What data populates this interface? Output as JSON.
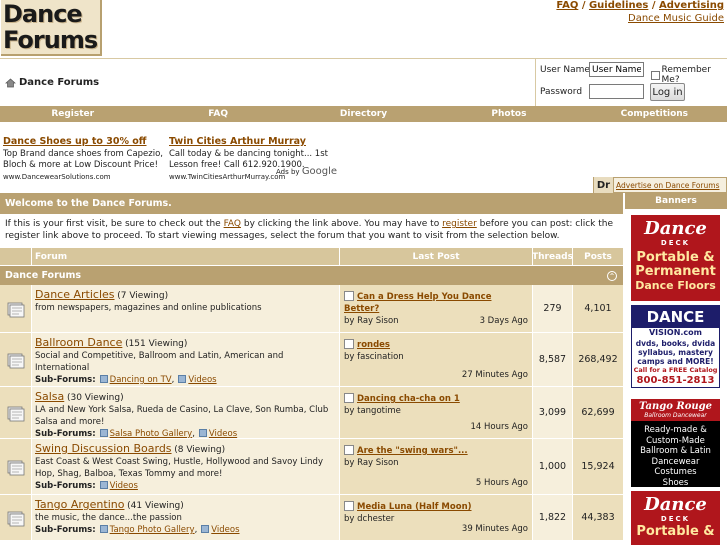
{
  "header": {
    "logo_line1": "Dance",
    "logo_line2": "Forums",
    "links": [
      "FAQ",
      "Guidelines",
      "Advertising"
    ],
    "separator": " / ",
    "sub_link": "Dance Music Guide"
  },
  "breadcrumb": {
    "label": "Dance Forums"
  },
  "login": {
    "user_label": "User Name",
    "user_value": "User Name",
    "pass_label": "Password",
    "remember_label": "Remember Me?",
    "button": "Log in"
  },
  "menu": [
    "Register",
    "FAQ",
    "Directory",
    "Photos",
    "Competitions"
  ],
  "ads": [
    {
      "title": "Dance Shoes up to 30% off",
      "lines": [
        "Top Brand dance shoes from Capezio,",
        "Bloch & more at Low Discount Price!"
      ],
      "url": "www.DancewearSolutions.com"
    },
    {
      "title": "Twin Cities Arthur Murray",
      "lines": [
        "Call today & be dancing tonight... 1st",
        "Lesson free! Call 612.920.1900."
      ],
      "url": "www.TwinCitiesArthurMurray.com"
    }
  ],
  "ads_by": "Ads by",
  "ads_by_brand": "Google",
  "advertise": {
    "badge": "Dr",
    "label": "Advertise on Dance Forums"
  },
  "welcome": {
    "title": "Welcome to the Dance Forums.",
    "text_before": "If this is your first visit, be sure to check out the ",
    "faq_link": "FAQ",
    "text_mid": " by clicking the link above. You may have to ",
    "register_link": "register",
    "text_after": " before you can post: click the register link above to proceed. To start viewing messages, select the forum that you want to visit from the selection below."
  },
  "columns": {
    "forum": "Forum",
    "last_post": "Last Post",
    "threads": "Threads",
    "posts": "Posts"
  },
  "category": {
    "title": "Dance Forums",
    "collapse_glyph": "^"
  },
  "subforums_label": "Sub-Forums:",
  "forums": [
    {
      "name": "Dance Articles",
      "viewing": "(7 Viewing)",
      "desc": "from newspapers, magazines and online publications",
      "subforums": [],
      "last_title": "Can a Dress Help You Dance Better?",
      "last_by": "by Ray Sison",
      "last_time": "3 Days Ago",
      "threads": "279",
      "posts": "4,101"
    },
    {
      "name": "Ballroom Dance",
      "viewing": "(151 Viewing)",
      "desc": "Social and Competitive, Ballroom and Latin, American and International",
      "subforums": [
        "Dancing on TV",
        "Videos"
      ],
      "last_title": "rondes",
      "last_by": "by fascination",
      "last_time": "27 Minutes Ago",
      "threads": "8,587",
      "posts": "268,492"
    },
    {
      "name": "Salsa",
      "viewing": "(30 Viewing)",
      "desc": "LA and New York Salsa, Rueda de Casino, La Clave, Son Rumba, Club Salsa and more!",
      "subforums": [
        "Salsa Photo Gallery",
        "Videos"
      ],
      "last_title": "Dancing cha-cha on 1",
      "last_by": "by tangotime",
      "last_time": "14 Hours Ago",
      "threads": "3,099",
      "posts": "62,699"
    },
    {
      "name": "Swing Discussion Boards",
      "viewing": "(8 Viewing)",
      "desc": "East Coast & West Coast Swing, Hustle, Hollywood and Savoy Lindy Hop, Shag, Balboa, Texas Tommy and more!",
      "subforums": [
        "Videos"
      ],
      "last_title": "Are the \"swing wars\"...",
      "last_by": "by Ray Sison",
      "last_time": "5 Hours Ago",
      "threads": "1,000",
      "posts": "15,924"
    },
    {
      "name": "Tango Argentino",
      "viewing": "(41 Viewing)",
      "desc": "the music, the dance...the passion",
      "subforums": [
        "Tango Photo Gallery",
        "Videos"
      ],
      "last_title": "Media Luna (Half Moon)",
      "last_by": "by dchester",
      "last_time": "39 Minutes Ago",
      "threads": "1,822",
      "posts": "44,383"
    }
  ],
  "banners": {
    "title": "Banners",
    "b1": {
      "script": "Dance",
      "sub": "DECK",
      "l1": "Portable &",
      "l2": "Permanent",
      "l3": "Dance Floors"
    },
    "b2": {
      "logo1": "DANCE",
      "logo2": "VISION.com",
      "l1": "dvds, books, dvida",
      "l2": "syllabus, mastery",
      "l3": "camps and MORE!",
      "l4": "Call for a FREE Catalog",
      "phone": "800-851-2813"
    },
    "b3": {
      "script": "Tango Rouge",
      "sub": "Ballroom Dancewear",
      "l1": "Ready-made &",
      "l2": "Custom-Made",
      "l3": "Ballroom & Latin",
      "l4": "Dancewear",
      "l5": "Costumes",
      "l6": "Shoes"
    },
    "b4": {
      "script": "Dance",
      "sub": "DECK",
      "l1": "Portable &"
    }
  }
}
